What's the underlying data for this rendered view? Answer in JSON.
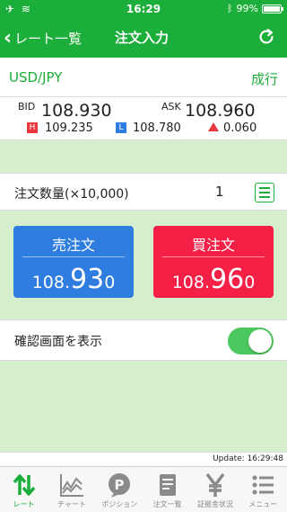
{
  "status": {
    "time": "16:29",
    "battery": "99%",
    "carrier_icon": "airplane-icon",
    "wifi_icon": "wifi-icon",
    "bluetooth_icon": "bluetooth-icon"
  },
  "nav": {
    "back_label": "レート一覧",
    "title": "注文入力",
    "refresh_icon": "refresh-icon"
  },
  "symbol": {
    "pair": "USD/JPY",
    "order_type": "成行"
  },
  "prices": {
    "bid_label": "BID",
    "bid": "108.930",
    "ask_label": "ASK",
    "ask": "108.960",
    "high_badge": "H",
    "high": "109.235",
    "low_badge": "L",
    "low": "108.780",
    "change": "0.060"
  },
  "quantity": {
    "label": "注文数量(×10,000)",
    "value": "1"
  },
  "sell": {
    "label": "売注文",
    "price_head": "108.",
    "price_big": "93",
    "price_tail": "0"
  },
  "buy": {
    "label": "買注文",
    "price_head": "108.",
    "price_big": "96",
    "price_tail": "0"
  },
  "confirm": {
    "label": "確認画面を表示",
    "enabled": true
  },
  "update": {
    "text": "Update: 16:29:48"
  },
  "tabs": [
    {
      "label": "レート",
      "icon": "rate-arrows-icon",
      "active": true
    },
    {
      "label": "チャート",
      "icon": "chart-icon",
      "active": false
    },
    {
      "label": "ポジション",
      "icon": "position-icon",
      "active": false
    },
    {
      "label": "注文一覧",
      "icon": "order-list-icon",
      "active": false
    },
    {
      "label": "証拠金状況",
      "icon": "yen-icon",
      "active": false
    },
    {
      "label": "メニュー",
      "icon": "menu-icon",
      "active": false
    }
  ],
  "colors": {
    "brand_green": "#1cae3a",
    "sell_blue": "#2f7de1",
    "buy_red": "#f42046",
    "background_green": "#d5efcc"
  }
}
